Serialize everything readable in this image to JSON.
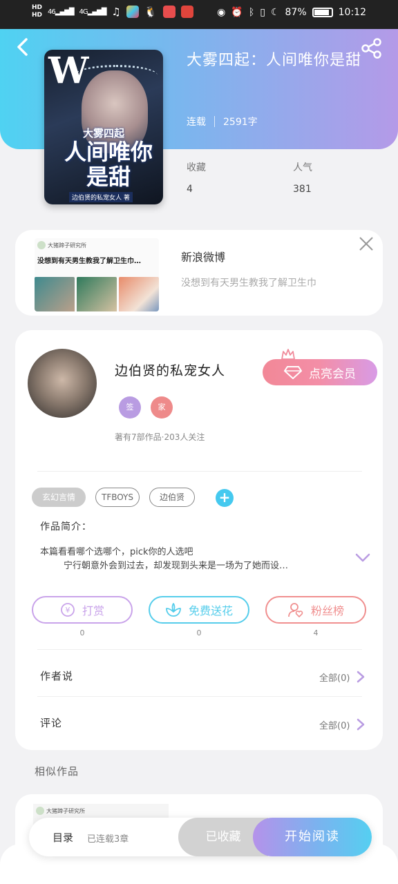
{
  "status_bar": {
    "hd1": "HD",
    "hd2": "HD",
    "net1": "46",
    "net2": "4G",
    "battery_percent": "87%",
    "battery_level": 0.87,
    "time": "10:12"
  },
  "book": {
    "title": "大雾四起：人间唯你是甜",
    "status": "连载",
    "word_count": "2591字",
    "favorites_label": "收藏",
    "favorites_value": "4",
    "popularity_label": "人气",
    "popularity_value": "381",
    "cover": {
      "logo_letter": "W",
      "small_title": "大雾四起",
      "big_title": "人间唯你是甜",
      "tagline": "边伯贤的私宠女人 著"
    }
  },
  "ad": {
    "thumb_account": "大猪蹄子研究所",
    "thumb_caption": "没想到有天男生教我了解卫生巾…",
    "source": "新浪微博",
    "description": "没想到有天男生教我了解卫生巾"
  },
  "author": {
    "name": "边伯贤的私宠女人",
    "badge1": "签",
    "badge2": "家",
    "stats": "著有7部作品·203人关注",
    "vip_button": "点亮会员"
  },
  "tags": [
    "玄幻言情",
    "TFBOYS",
    "边伯贤"
  ],
  "intro": {
    "label": "作品简介：",
    "line1": "本篇看看哪个选哪个，pick你的人选吧",
    "line2": "宁行朝意外会到过去，却发现到头来是一场为了她而设…"
  },
  "actions": [
    {
      "label": "打赏",
      "count": "0",
      "color": "#c9a3ea"
    },
    {
      "label": "免费送花",
      "count": "0",
      "color": "#55cdeb"
    },
    {
      "label": "粉丝榜",
      "count": "4",
      "color": "#f08f8f"
    }
  ],
  "rows": {
    "author_says": "作者说",
    "author_says_all": "全部(0)",
    "comments": "评论",
    "comments_all": "全部(0)"
  },
  "similar": {
    "label": "相似作品",
    "thumb_account": "大猪蹄子研究所"
  },
  "bottom_bar": {
    "toc": "目录",
    "serial_status": "已连载3章",
    "collected": "已收藏",
    "start_reading": "开始阅读"
  },
  "colors": {
    "accent_cyan": "#4fd2f2",
    "accent_purple": "#b49ae8",
    "vip_pink": "#f28897"
  }
}
